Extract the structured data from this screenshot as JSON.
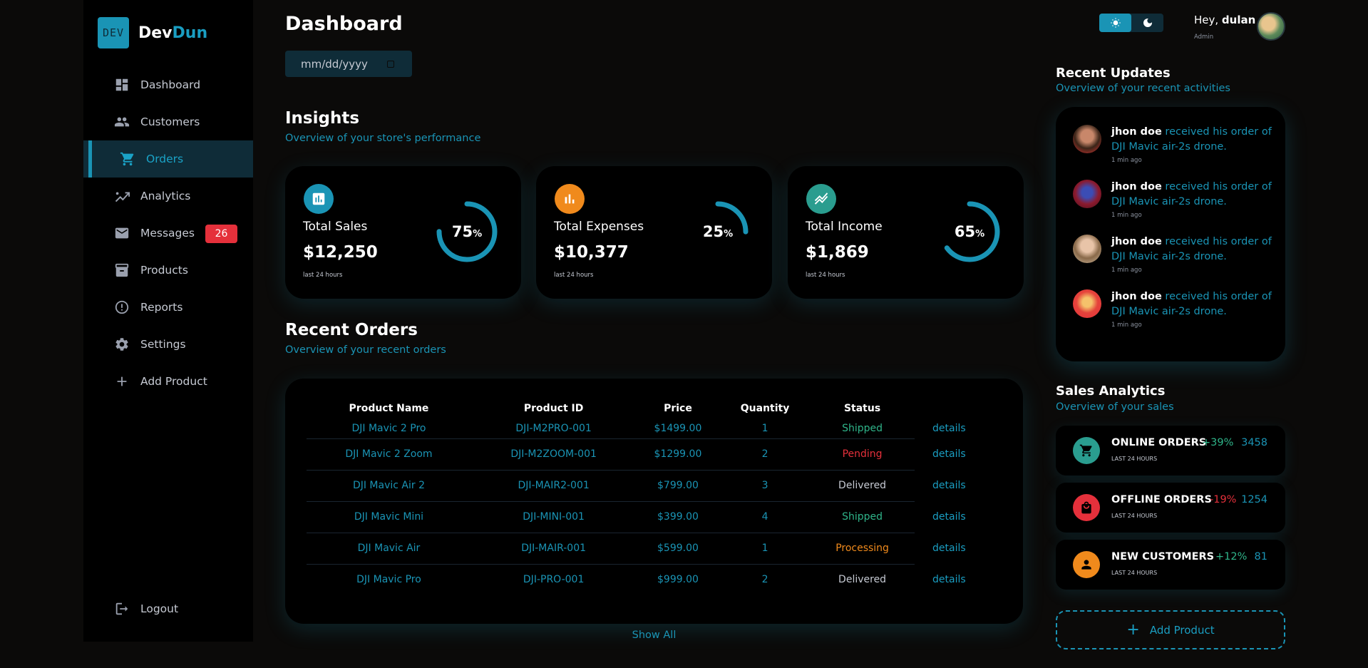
{
  "brand": {
    "logo_text": "DEV",
    "name_part1": "Dev",
    "name_part2": "Dun"
  },
  "sidebar": {
    "items": [
      {
        "label": "Dashboard",
        "icon": "dashboard-icon"
      },
      {
        "label": "Customers",
        "icon": "people-icon"
      },
      {
        "label": "Orders",
        "icon": "cart-icon",
        "active": true
      },
      {
        "label": "Analytics",
        "icon": "analytics-icon"
      },
      {
        "label": "Messages",
        "icon": "mail-icon",
        "badge": "26"
      },
      {
        "label": "Products",
        "icon": "box-icon"
      },
      {
        "label": "Reports",
        "icon": "alert-icon"
      },
      {
        "label": "Settings",
        "icon": "gear-icon"
      },
      {
        "label": "Add Product",
        "icon": "plus-icon"
      }
    ],
    "logout_label": "Logout"
  },
  "header": {
    "title": "Dashboard",
    "date_placeholder": "mm/dd/yyyy"
  },
  "insights": {
    "title": "Insights",
    "subtitle": "Overview of your store's performance",
    "cards": [
      {
        "label": "Total Sales",
        "value": "$12,250",
        "note": "last 24 hours",
        "percent": 75,
        "percent_text": "75",
        "unit": "%",
        "icon_color": "#1a94b5"
      },
      {
        "label": "Total Expenses",
        "value": "$10,377",
        "note": "last 24 hours",
        "percent": 25,
        "percent_text": "25",
        "unit": "%",
        "icon_color": "#f08a1c"
      },
      {
        "label": "Total Income",
        "value": "$1,869",
        "note": "last 24 hours",
        "percent": 65,
        "percent_text": "65",
        "unit": "%",
        "icon_color": "#2a9d8f"
      }
    ]
  },
  "orders": {
    "title": "Recent Orders",
    "subtitle": "Overview of your recent orders",
    "columns": [
      "Product Name",
      "Product ID",
      "Price",
      "Quantity",
      "Status"
    ],
    "rows": [
      {
        "name": "DJI Mavic 2 Pro",
        "id": "DJI-M2PRO-001",
        "price": "$1499.00",
        "qty": "1",
        "status": "Shipped",
        "action": "details"
      },
      {
        "name": "DJI Mavic 2 Zoom",
        "id": "DJI-M2ZOOM-001",
        "price": "$1299.00",
        "qty": "2",
        "status": "Pending",
        "action": "details"
      },
      {
        "name": "DJI Mavic Air 2",
        "id": "DJI-MAIR2-001",
        "price": "$799.00",
        "qty": "3",
        "status": "Delivered",
        "action": "details"
      },
      {
        "name": "DJI Mavic Mini",
        "id": "DJI-MINI-001",
        "price": "$399.00",
        "qty": "4",
        "status": "Shipped",
        "action": "details"
      },
      {
        "name": "DJI Mavic Air",
        "id": "DJI-MAIR-001",
        "price": "$599.00",
        "qty": "1",
        "status": "Processing",
        "action": "details"
      },
      {
        "name": "DJI Mavic Pro",
        "id": "DJI-PRO-001",
        "price": "$999.00",
        "qty": "2",
        "status": "Delivered",
        "action": "details"
      }
    ],
    "show_all": "Show All"
  },
  "profile": {
    "greeting": "Hey, ",
    "name": "dulan",
    "role": "Admin"
  },
  "updates": {
    "title": "Recent Updates",
    "subtitle": "Overview of your recent activities",
    "items": [
      {
        "name": "jhon doe",
        "text": " received his order of DJI Mavic air-2s drone.",
        "time": "1 min ago"
      },
      {
        "name": "jhon doe",
        "text": " received his order of DJI Mavic air-2s drone.",
        "time": "1 min ago"
      },
      {
        "name": "jhon doe",
        "text": " received his order of DJI Mavic air-2s drone.",
        "time": "1 min ago"
      },
      {
        "name": "jhon doe",
        "text": " received his order of DJI Mavic air-2s drone.",
        "time": "1 min ago"
      }
    ]
  },
  "sales_analytics": {
    "title": "Sales Analytics",
    "subtitle": "Overview of your sales",
    "items": [
      {
        "name": "ONLINE ORDERS",
        "note": "LAST 24 HOURS",
        "pct": "+39%",
        "num": "3458",
        "color": "#2a9d8f",
        "pct_color": "#2fb58a",
        "icon": "cart-icon"
      },
      {
        "name": "OFFLINE ORDERS",
        "note": "LAST 24 HOURS",
        "pct": "-19%",
        "num": "1254",
        "color": "#e5303b",
        "pct_color": "#e5303b",
        "icon": "bag-icon"
      },
      {
        "name": "NEW CUSTOMERS",
        "note": "LAST 24 HOURS",
        "pct": "+12%",
        "num": "81",
        "color": "#f08a1c",
        "pct_color": "#2fb58a",
        "icon": "person-icon"
      }
    ],
    "add_product": "Add Product"
  }
}
